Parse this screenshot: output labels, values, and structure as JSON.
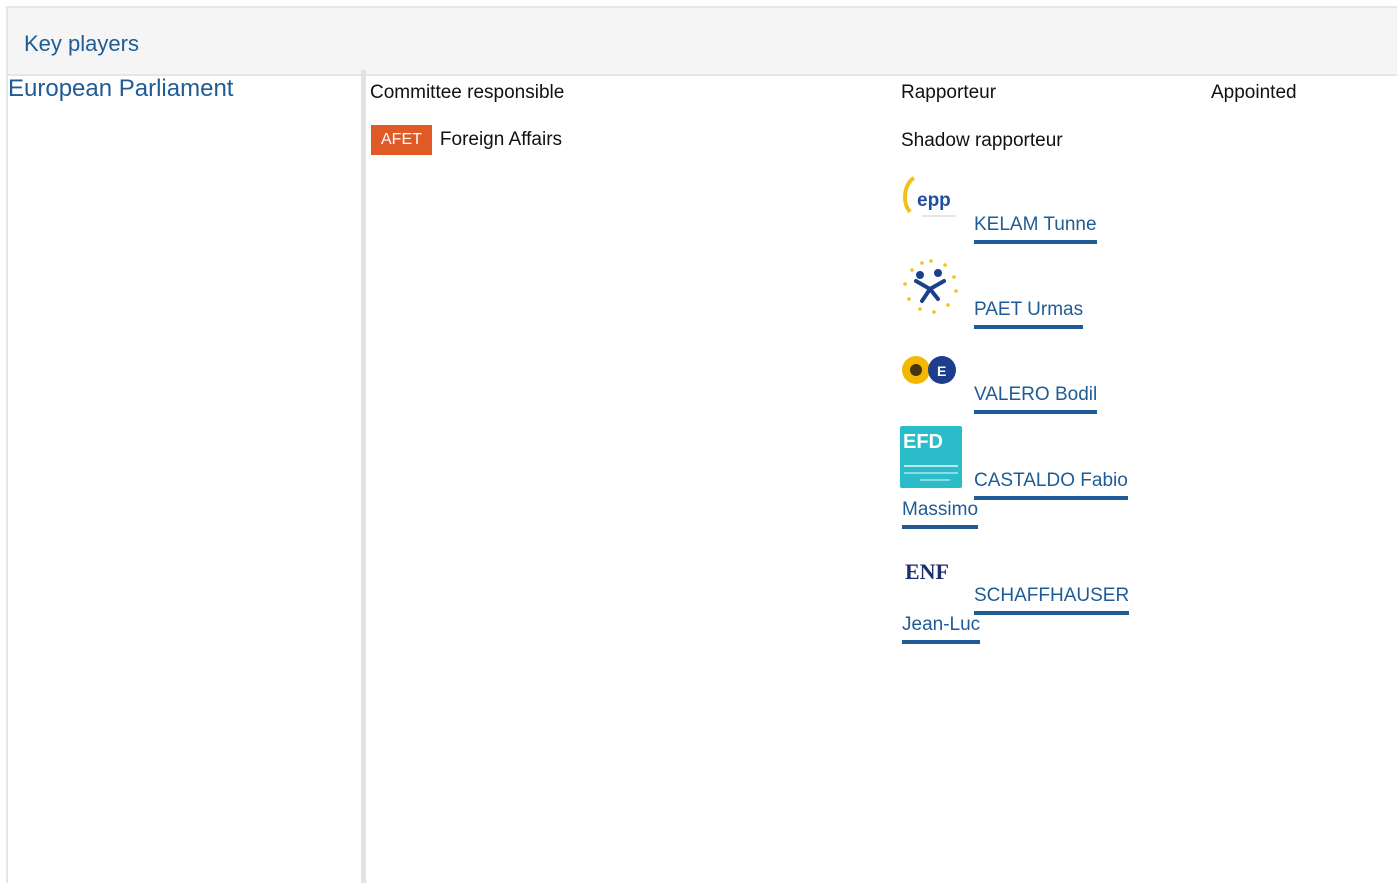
{
  "header": {
    "title": "Key players"
  },
  "institution": "European Parliament",
  "columns": {
    "committee": "Committee responsible",
    "rapporteur": "Rapporteur",
    "appointed": "Appointed"
  },
  "committee": {
    "code": "AFET",
    "name": "Foreign Affairs",
    "badge_color": "#e05a26"
  },
  "shadow_label": "Shadow rapporteur",
  "shadow_rapporteurs": [
    {
      "group_logo": "epp-logo-icon",
      "name_line1": "KELAM Tunne",
      "name_line2": ""
    },
    {
      "group_logo": "alde-logo-icon",
      "name_line1": "PAET Urmas",
      "name_line2": ""
    },
    {
      "group_logo": "greens-efa-logo-icon",
      "name_line1": "VALERO Bodil",
      "name_line2": ""
    },
    {
      "group_logo": "efdd-logo-icon",
      "name_line1": "CASTALDO Fabio",
      "name_line2": "Massimo"
    },
    {
      "group_logo": "enf-logo-icon",
      "name_line1": "SCHAFFHAUSER",
      "name_line2": "Jean-Luc"
    }
  ],
  "logo_text": {
    "epp": "epp",
    "efd": "EFD",
    "enf": "ENF"
  },
  "colors": {
    "link": "#1f5c96",
    "header_bg": "#f5f5f5",
    "border": "#e6e6e6"
  }
}
